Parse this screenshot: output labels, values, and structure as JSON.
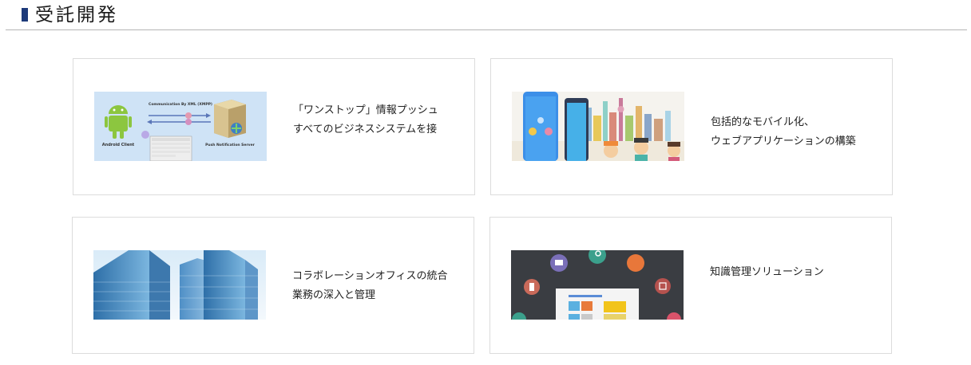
{
  "header": {
    "title": "受託開発"
  },
  "cards": [
    {
      "line1": "「ワンストップ」情報プッシュ",
      "line2": "すべてのビジネスシステムを接",
      "image": {
        "caption_top": "Communication By XML (XMPP)",
        "caption_left": "Android Client",
        "caption_right": "Push Notification Server"
      }
    },
    {
      "line1": "包括的なモバイル化、",
      "line2": "ウェブアプリケーションの構築"
    },
    {
      "line1": "コラボレーションオフィスの統合",
      "line2": "業務の深入と管理"
    },
    {
      "line1": "知識管理ソリューション",
      "line2": ""
    }
  ],
  "colors": {
    "marker": "#1d3a7a",
    "border": "#dcdcdc",
    "divider": "#b5b5b5"
  }
}
